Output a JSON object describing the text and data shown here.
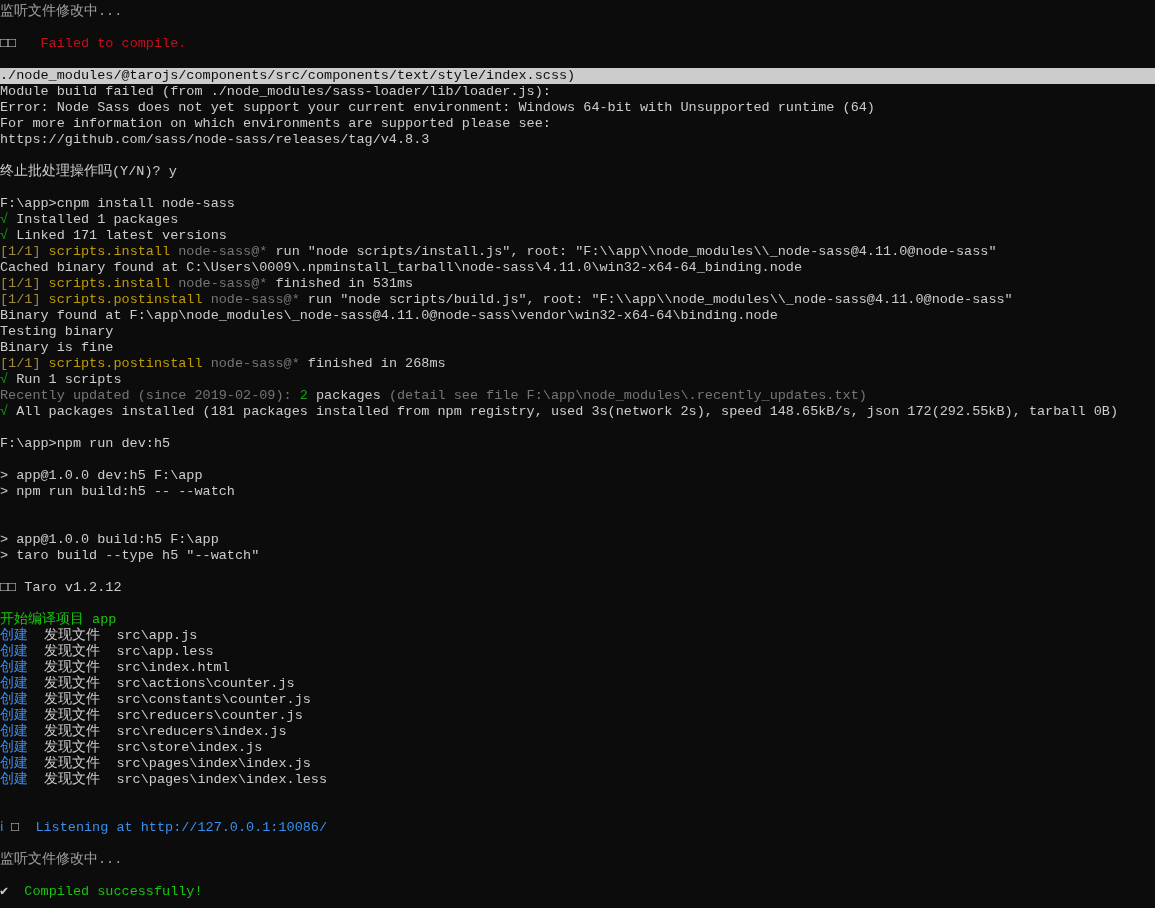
{
  "terminal": {
    "lines": [
      {
        "kind": "plain",
        "segments": [
          {
            "kind": "muted",
            "text": "监听文件修改中..."
          }
        ]
      },
      {
        "kind": "blank"
      },
      {
        "kind": "plain",
        "segments": [
          {
            "kind": "plain",
            "text": "□□   "
          },
          {
            "kind": "red",
            "text": "Failed to compile."
          }
        ]
      },
      {
        "kind": "blank"
      },
      {
        "kind": "highlighted",
        "segments": [
          {
            "kind": "plain",
            "text": "./node_modules/@tarojs/components/src/components/text/style/index.scss)"
          }
        ]
      },
      {
        "kind": "plain",
        "segments": [
          {
            "kind": "plain",
            "text": "Module build failed (from ./node_modules/sass-loader/lib/loader.js):"
          }
        ]
      },
      {
        "kind": "plain",
        "segments": [
          {
            "kind": "plain",
            "text": "Error: Node Sass does not yet support your current environment: Windows 64-bit with Unsupported runtime (64)"
          }
        ]
      },
      {
        "kind": "plain",
        "segments": [
          {
            "kind": "plain",
            "text": "For more information on which environments are supported please see:"
          }
        ]
      },
      {
        "kind": "plain",
        "segments": [
          {
            "kind": "plain",
            "text": "https://github.com/sass/node-sass/releases/tag/v4.8.3"
          }
        ]
      },
      {
        "kind": "blank"
      },
      {
        "kind": "plain",
        "segments": [
          {
            "kind": "plain",
            "text": "终止批处理操作吗(Y/N)? y"
          }
        ]
      },
      {
        "kind": "blank"
      },
      {
        "kind": "plain",
        "segments": [
          {
            "kind": "plain",
            "text": "F:\\app>cnpm install node-sass"
          }
        ]
      },
      {
        "kind": "plain",
        "segments": [
          {
            "kind": "dimgreen",
            "text": "√"
          },
          {
            "kind": "plain",
            "text": " Installed 1 packages"
          }
        ]
      },
      {
        "kind": "plain",
        "segments": [
          {
            "kind": "dimgreen",
            "text": "√"
          },
          {
            "kind": "plain",
            "text": " Linked 171 latest versions"
          }
        ]
      },
      {
        "kind": "plain",
        "segments": [
          {
            "kind": "dimyellow",
            "text": "[1/1]"
          },
          {
            "kind": "yellow",
            "text": " scripts.install"
          },
          {
            "kind": "gray",
            "text": " node-sass@*"
          },
          {
            "kind": "plain",
            "text": " run \"node scripts/install.js\", root: \"F:\\\\app\\\\node_modules\\\\_node-sass@4.11.0@node-sass\""
          }
        ]
      },
      {
        "kind": "plain",
        "segments": [
          {
            "kind": "plain",
            "text": "Cached binary found at C:\\Users\\0009\\.npminstall_tarball\\node-sass\\4.11.0\\win32-x64-64_binding.node"
          }
        ]
      },
      {
        "kind": "plain",
        "segments": [
          {
            "kind": "dimyellow",
            "text": "[1/1]"
          },
          {
            "kind": "yellow",
            "text": " scripts.install"
          },
          {
            "kind": "gray",
            "text": " node-sass@*"
          },
          {
            "kind": "plain",
            "text": " finished in 531ms"
          }
        ]
      },
      {
        "kind": "plain",
        "segments": [
          {
            "kind": "dimyellow",
            "text": "[1/1]"
          },
          {
            "kind": "yellow",
            "text": " scripts.postinstall"
          },
          {
            "kind": "gray",
            "text": " node-sass@*"
          },
          {
            "kind": "plain",
            "text": " run \"node scripts/build.js\", root: \"F:\\\\app\\\\node_modules\\\\_node-sass@4.11.0@node-sass\""
          }
        ]
      },
      {
        "kind": "plain",
        "segments": [
          {
            "kind": "plain",
            "text": "Binary found at F:\\app\\node_modules\\_node-sass@4.11.0@node-sass\\vendor\\win32-x64-64\\binding.node"
          }
        ]
      },
      {
        "kind": "plain",
        "segments": [
          {
            "kind": "plain",
            "text": "Testing binary"
          }
        ]
      },
      {
        "kind": "plain",
        "segments": [
          {
            "kind": "plain",
            "text": "Binary is fine"
          }
        ]
      },
      {
        "kind": "plain",
        "segments": [
          {
            "kind": "dimyellow",
            "text": "[1/1]"
          },
          {
            "kind": "yellow",
            "text": " scripts.postinstall"
          },
          {
            "kind": "gray",
            "text": " node-sass@*"
          },
          {
            "kind": "plain",
            "text": " finished in 268ms"
          }
        ]
      },
      {
        "kind": "plain",
        "segments": [
          {
            "kind": "dimgreen",
            "text": "√"
          },
          {
            "kind": "plain",
            "text": " Run 1 scripts"
          }
        ]
      },
      {
        "kind": "plain",
        "segments": [
          {
            "kind": "gray",
            "text": "Recently updated (since 2019-02-09): "
          },
          {
            "kind": "dimgreen",
            "text": "2"
          },
          {
            "kind": "plain",
            "text": " packages "
          },
          {
            "kind": "gray",
            "text": "(detail see file F:\\app\\node_modules\\.recently_updates.txt)"
          }
        ]
      },
      {
        "kind": "plain",
        "segments": [
          {
            "kind": "dimgreen",
            "text": "√"
          },
          {
            "kind": "plain",
            "text": " All packages installed (181 packages installed from npm registry, used 3s(network 2s), speed 148.65kB/s, json 172(292.55kB), tarball 0B)"
          }
        ]
      },
      {
        "kind": "blank"
      },
      {
        "kind": "plain",
        "segments": [
          {
            "kind": "plain",
            "text": "F:\\app>npm run dev:h5"
          }
        ]
      },
      {
        "kind": "blank"
      },
      {
        "kind": "plain",
        "segments": [
          {
            "kind": "plain",
            "text": "> app@1.0.0 dev:h5 F:\\app"
          }
        ]
      },
      {
        "kind": "plain",
        "segments": [
          {
            "kind": "plain",
            "text": "> npm run build:h5 -- --watch"
          }
        ]
      },
      {
        "kind": "blank"
      },
      {
        "kind": "blank"
      },
      {
        "kind": "plain",
        "segments": [
          {
            "kind": "plain",
            "text": "> app@1.0.0 build:h5 F:\\app"
          }
        ]
      },
      {
        "kind": "plain",
        "segments": [
          {
            "kind": "plain",
            "text": "> taro build --type h5 \"--watch\""
          }
        ]
      },
      {
        "kind": "blank"
      },
      {
        "kind": "plain",
        "segments": [
          {
            "kind": "plain",
            "text": "□□ Taro v1.2.12"
          }
        ]
      },
      {
        "kind": "blank"
      },
      {
        "kind": "plain",
        "segments": [
          {
            "kind": "green",
            "text": "开始编译项目 app"
          }
        ]
      },
      {
        "kind": "plain",
        "segments": [
          {
            "kind": "blue",
            "text": "创建"
          },
          {
            "kind": "plain",
            "text": "  发现文件  src\\app.js"
          }
        ]
      },
      {
        "kind": "plain",
        "segments": [
          {
            "kind": "blue",
            "text": "创建"
          },
          {
            "kind": "plain",
            "text": "  发现文件  src\\app.less"
          }
        ]
      },
      {
        "kind": "plain",
        "segments": [
          {
            "kind": "blue",
            "text": "创建"
          },
          {
            "kind": "plain",
            "text": "  发现文件  src\\index.html"
          }
        ]
      },
      {
        "kind": "plain",
        "segments": [
          {
            "kind": "blue",
            "text": "创建"
          },
          {
            "kind": "plain",
            "text": "  发现文件  src\\actions\\counter.js"
          }
        ]
      },
      {
        "kind": "plain",
        "segments": [
          {
            "kind": "blue",
            "text": "创建"
          },
          {
            "kind": "plain",
            "text": "  发现文件  src\\constants\\counter.js"
          }
        ]
      },
      {
        "kind": "plain",
        "segments": [
          {
            "kind": "blue",
            "text": "创建"
          },
          {
            "kind": "plain",
            "text": "  发现文件  src\\reducers\\counter.js"
          }
        ]
      },
      {
        "kind": "plain",
        "segments": [
          {
            "kind": "blue",
            "text": "创建"
          },
          {
            "kind": "plain",
            "text": "  发现文件  src\\reducers\\index.js"
          }
        ]
      },
      {
        "kind": "plain",
        "segments": [
          {
            "kind": "blue",
            "text": "创建"
          },
          {
            "kind": "plain",
            "text": "  发现文件  src\\store\\index.js"
          }
        ]
      },
      {
        "kind": "plain",
        "segments": [
          {
            "kind": "blue",
            "text": "创建"
          },
          {
            "kind": "plain",
            "text": "  发现文件  src\\pages\\index\\index.js"
          }
        ]
      },
      {
        "kind": "plain",
        "segments": [
          {
            "kind": "blue",
            "text": "创建"
          },
          {
            "kind": "plain",
            "text": "  发现文件  src\\pages\\index\\index.less"
          }
        ]
      },
      {
        "kind": "blank"
      },
      {
        "kind": "blank"
      },
      {
        "kind": "plain",
        "segments": [
          {
            "kind": "blue",
            "text": "ℹ"
          },
          {
            "kind": "plain",
            "text": " □  "
          },
          {
            "kind": "blue",
            "text": "Listening at http://127.0.0.1:10086/"
          }
        ]
      },
      {
        "kind": "blank"
      },
      {
        "kind": "plain",
        "segments": [
          {
            "kind": "muted",
            "text": "监听文件修改中..."
          }
        ]
      },
      {
        "kind": "blank"
      },
      {
        "kind": "plain",
        "segments": [
          {
            "kind": "plain",
            "text": "✔  "
          },
          {
            "kind": "green",
            "text": "Compiled successfully!"
          }
        ]
      }
    ]
  }
}
